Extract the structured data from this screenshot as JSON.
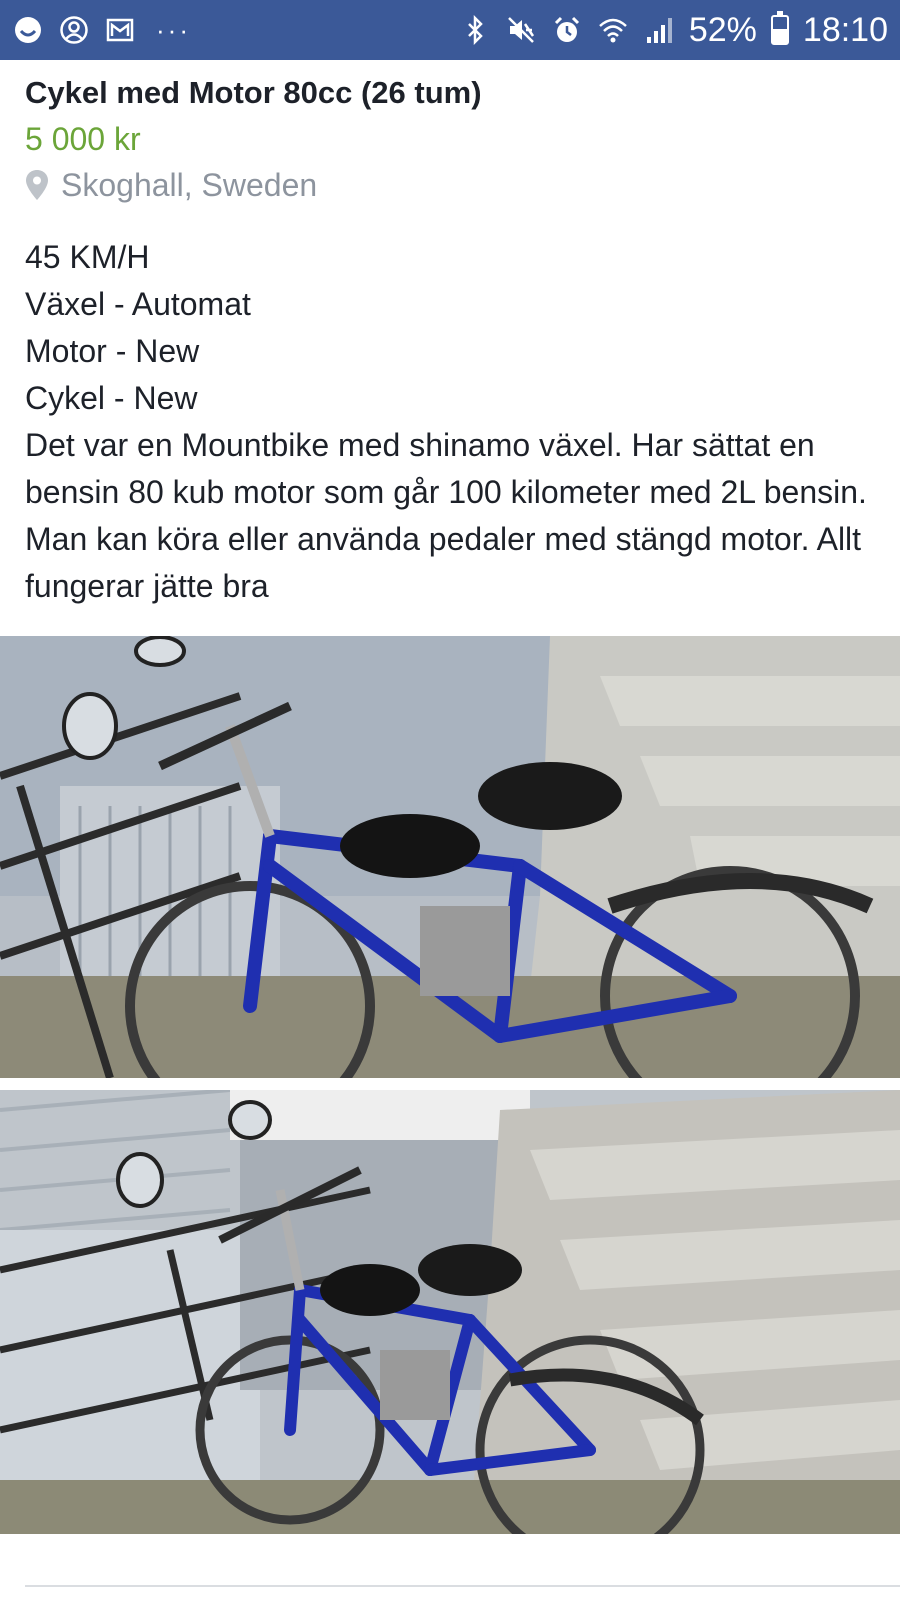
{
  "status_bar": {
    "battery_percent": "52%",
    "battery_level": 0.52,
    "time": "18:10",
    "left_icons": [
      "smiley-icon",
      "account-icon",
      "mail-icon"
    ],
    "overflow": "···",
    "right_icons": [
      "bluetooth-icon",
      "mute-icon",
      "alarm-icon",
      "wifi-icon",
      "signal-icon",
      "battery-icon"
    ],
    "background_color": "#3b5998"
  },
  "listing": {
    "title": "Cykel med Motor 80cc (26 tum)",
    "price": "5 000 kr",
    "price_color": "#6ba539",
    "location": "Skoghall, Sweden",
    "description_lines": [
      "45 KM/H",
      "Växel - Automat",
      "Motor - New",
      "Cykel - New",
      "Det var en Mountbike med shinamo växel. Har sättat en bensin 80 kub motor som går 100 kilometer med 2L bensin. Man kan köra eller använda pedaler med stängd motor. Allt fungerar jätte bra"
    ]
  },
  "photos": [
    {
      "subject": "blue motorized bicycle beside concrete steps"
    },
    {
      "subject": "blue motorized bicycle beside concrete steps"
    }
  ]
}
